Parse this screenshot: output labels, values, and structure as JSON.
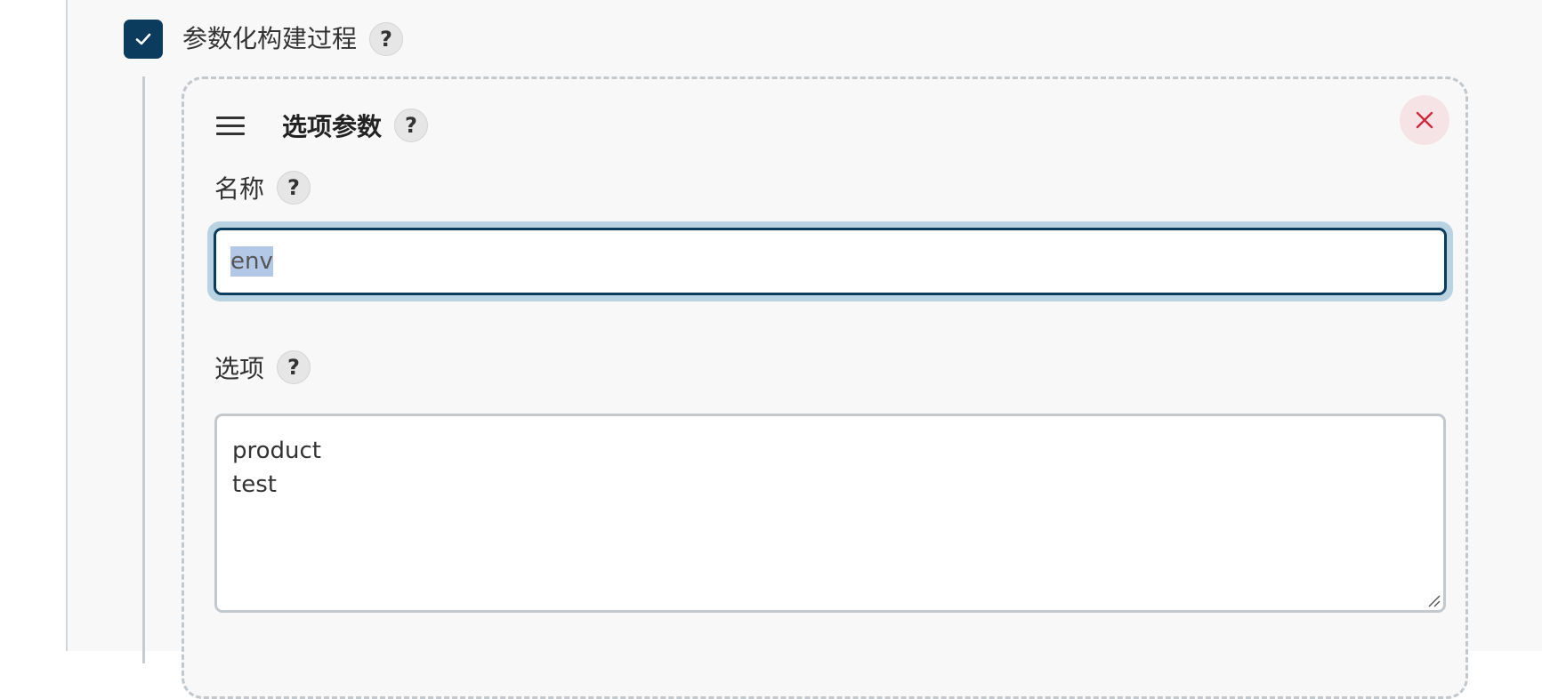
{
  "parameterized": {
    "label": "参数化构建过程",
    "checked": true,
    "help": "?"
  },
  "choice_param": {
    "title": "选项参数",
    "help": "?",
    "close_icon": "close-icon",
    "drag_icon": "drag-handle-icon",
    "name_field": {
      "label": "名称",
      "help": "?",
      "value": "env"
    },
    "choices_field": {
      "label": "选项",
      "help": "?",
      "lines": [
        "product",
        "test"
      ]
    }
  },
  "colors": {
    "accent": "#0b3c5d",
    "close": "#d0283f",
    "focus_ring": "#b9d3e3"
  }
}
